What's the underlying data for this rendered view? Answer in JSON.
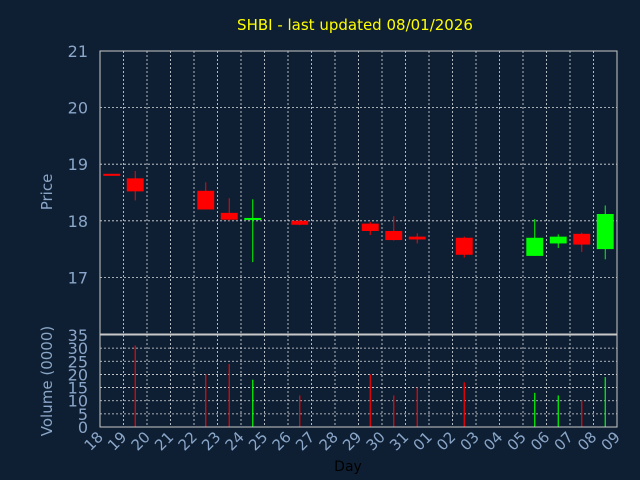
{
  "chart_data": {
    "type": "candlestick",
    "title": "SHBI - last updated 08/01/2026",
    "xlabel": "Day",
    "price_panel": {
      "ylabel": "Price",
      "ylim": [
        16.0,
        21.0
      ],
      "yticks": [
        17,
        18,
        19,
        20,
        21
      ],
      "grid": true
    },
    "volume_panel": {
      "ylabel": "Volume (0000)",
      "ylim": [
        0,
        35
      ],
      "yticks": [
        0,
        5,
        10,
        15,
        20,
        25,
        30,
        35
      ],
      "grid": true
    },
    "xticks": [
      "18",
      "19",
      "20",
      "21",
      "22",
      "23",
      "24",
      "25",
      "26",
      "27",
      "28",
      "29",
      "30",
      "31",
      "01",
      "02",
      "03",
      "04",
      "05",
      "06",
      "07",
      "08",
      "09"
    ],
    "candles": [
      {
        "day": "18",
        "open": 18.83,
        "high": 18.83,
        "low": 18.82,
        "close": 18.82,
        "volume": 0
      },
      {
        "day": "19",
        "open": 18.75,
        "high": 18.88,
        "low": 18.36,
        "close": 18.52,
        "volume": 31
      },
      {
        "day": "22",
        "open": 18.53,
        "high": 18.68,
        "low": 18.2,
        "close": 18.2,
        "volume": 20
      },
      {
        "day": "23",
        "open": 18.14,
        "high": 18.4,
        "low": 18.0,
        "close": 18.02,
        "volume": 24
      },
      {
        "day": "24",
        "open": 18.02,
        "high": 18.38,
        "low": 17.27,
        "close": 18.05,
        "volume": 18
      },
      {
        "day": "26",
        "open": 18.0,
        "high": 18.02,
        "low": 17.92,
        "close": 17.93,
        "volume": 12
      },
      {
        "day": "29",
        "open": 17.95,
        "high": 17.98,
        "low": 17.75,
        "close": 17.82,
        "volume": 20
      },
      {
        "day": "30",
        "open": 17.82,
        "high": 18.08,
        "low": 17.65,
        "close": 17.66,
        "volume": 12
      },
      {
        "day": "31",
        "open": 17.72,
        "high": 17.78,
        "low": 17.6,
        "close": 17.67,
        "volume": 15
      },
      {
        "day": "02",
        "open": 17.7,
        "high": 17.72,
        "low": 17.35,
        "close": 17.4,
        "volume": 17
      },
      {
        "day": "05",
        "open": 17.38,
        "high": 18.03,
        "low": 17.38,
        "close": 17.7,
        "volume": 13
      },
      {
        "day": "06",
        "open": 17.6,
        "high": 17.76,
        "low": 17.52,
        "close": 17.72,
        "volume": 12
      },
      {
        "day": "07",
        "open": 17.77,
        "high": 17.79,
        "low": 17.45,
        "close": 17.58,
        "volume": 10
      },
      {
        "day": "08",
        "open": 17.5,
        "high": 18.27,
        "low": 17.32,
        "close": 18.12,
        "volume": 19
      }
    ],
    "colors": {
      "background": "#0f1f33",
      "up": "#00ff00",
      "down": "#ff0000",
      "title": "#ffff00",
      "axis_text": "#8aa6c8",
      "grid": "#ffffff"
    }
  }
}
